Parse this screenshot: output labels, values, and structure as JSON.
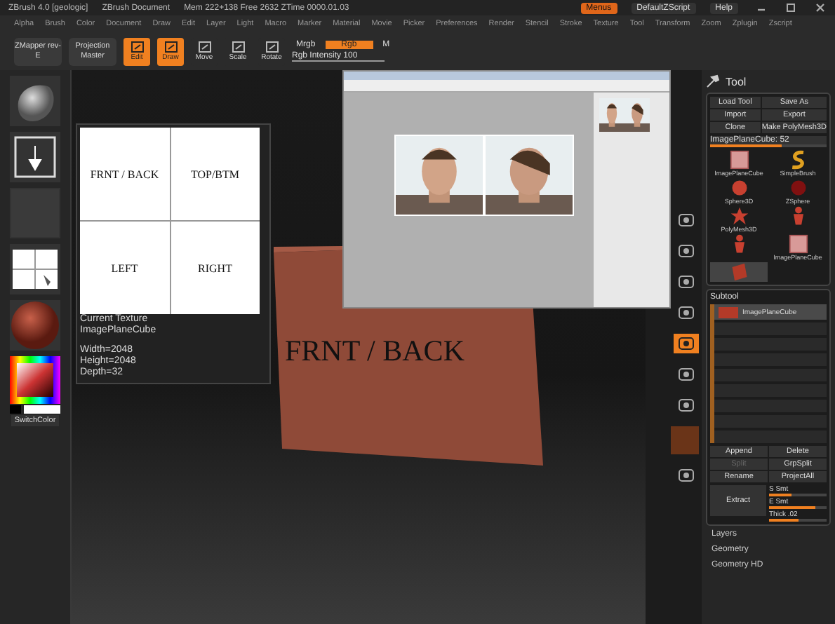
{
  "title_bar": {
    "app": "ZBrush 4.0 [geologic]",
    "document": "ZBrush Document",
    "stats": "Mem 222+138 Free 2632 ZTime 0000.01.03",
    "menus_button": {
      "label": "Menus",
      "on": true
    },
    "script": "DefaultZScript",
    "help": "Help"
  },
  "menu": [
    "Alpha",
    "Brush",
    "Color",
    "Document",
    "Draw",
    "Edit",
    "Layer",
    "Light",
    "Macro",
    "Marker",
    "Material",
    "Movie",
    "Picker",
    "Preferences",
    "Render",
    "Stencil",
    "Stroke",
    "Texture",
    "Tool",
    "Transform",
    "Zoom",
    "Zplugin",
    "Zscript"
  ],
  "toolbar": [
    {
      "kind": "button",
      "label": "ZMapper rev-E"
    },
    {
      "kind": "button",
      "label": "Projection Master"
    },
    {
      "kind": "toggle",
      "label": "Edit",
      "on": true
    },
    {
      "kind": "toggle",
      "label": "Draw",
      "on": true
    },
    {
      "kind": "toggle",
      "label": "Move",
      "on": false
    },
    {
      "kind": "toggle",
      "label": "Scale",
      "on": false
    },
    {
      "kind": "toggle",
      "label": "Rotate",
      "on": false
    }
  ],
  "color_mode": [
    {
      "label": "Mrgb",
      "selected": false
    },
    {
      "label": "Rgb",
      "selected": true
    },
    {
      "label": "M",
      "selected": false
    }
  ],
  "rgb_intensity": {
    "label": "Rgb Intensity 100",
    "level": 1
  },
  "shelf": [
    {
      "kind": "brush"
    },
    {
      "kind": "stroke"
    },
    {
      "kind": "alpha"
    },
    {
      "kind": "texture"
    },
    {
      "kind": "material"
    }
  ],
  "switch_color": "SwitchColor",
  "texture_popup": {
    "cells": [
      "FRNT / BACK",
      "TOP/BTM",
      "LEFT",
      "RIGHT"
    ],
    "caption": "Current Texture",
    "name": "ImagePlaneCube",
    "details": [
      "Width=2048",
      "Height=2048",
      "Depth=32"
    ]
  },
  "model_label": "FRNT / BACK",
  "dock": [
    {
      "kind": "tool",
      "on": false
    },
    {
      "kind": "tool",
      "on": false
    },
    {
      "kind": "tool",
      "on": false
    },
    {
      "kind": "tool",
      "on": false
    },
    {
      "kind": "toggle",
      "on": true
    },
    {
      "kind": "tool",
      "on": false
    },
    {
      "kind": "tool",
      "on": false
    },
    {
      "kind": "swatch",
      "on": false
    },
    {
      "kind": "tool",
      "on": false
    }
  ],
  "tool_panel": {
    "title": "Tool",
    "buttons": [
      "Load Tool",
      "Save As",
      "Import",
      "Export",
      "Clone",
      "Make PolyMesh3D"
    ],
    "current": {
      "label": "ImagePlaneCube: 52",
      "level": 0.62
    },
    "tools": [
      {
        "kind": "cube",
        "label": "ImagePlaneCube",
        "selected": false
      },
      {
        "kind": "brush",
        "label": "SimpleBrush",
        "selected": false
      },
      {
        "kind": "sphere",
        "label": "Sphere3D",
        "selected": false
      },
      {
        "kind": "zsphere",
        "label": "ZSphere",
        "selected": false
      },
      {
        "kind": "star",
        "label": "PolyMesh3D",
        "selected": false
      },
      {
        "kind": "figure",
        "selected": false
      },
      {
        "kind": "figure",
        "selected": false
      },
      {
        "kind": "cube",
        "label": "ImagePlaneCube",
        "selected": false
      },
      {
        "kind": "redcube",
        "selected": true
      }
    ]
  },
  "subtool": {
    "title": "Subtool",
    "slots": [
      {
        "kind": "mesh",
        "label": "ImagePlaneCube",
        "selected": true
      },
      {
        "kind": "empty",
        "selected": false
      },
      {
        "kind": "empty",
        "selected": false
      },
      {
        "kind": "empty",
        "selected": false
      },
      {
        "kind": "empty",
        "selected": false
      },
      {
        "kind": "empty",
        "selected": false
      },
      {
        "kind": "empty",
        "selected": false
      },
      {
        "kind": "empty",
        "selected": false
      },
      {
        "kind": "empty",
        "selected": false
      }
    ],
    "buttons": [
      {
        "label": "Append",
        "disabled": false
      },
      {
        "label": "Delete",
        "disabled": false
      },
      {
        "label": "Split",
        "disabled": true
      },
      {
        "label": "GrpSplit",
        "disabled": false
      },
      {
        "label": "Rename",
        "disabled": false
      },
      {
        "label": "ProjectAll",
        "disabled": false
      }
    ],
    "extract": "Extract",
    "extract_sliders": [
      {
        "label": "S Smt",
        "level": 0.4
      },
      {
        "label": "E Smt",
        "level": 0.8
      },
      {
        "label": "Thick .02",
        "level": 0.5
      }
    ]
  },
  "sections": [
    "Layers",
    "Geometry",
    "Geometry HD"
  ]
}
